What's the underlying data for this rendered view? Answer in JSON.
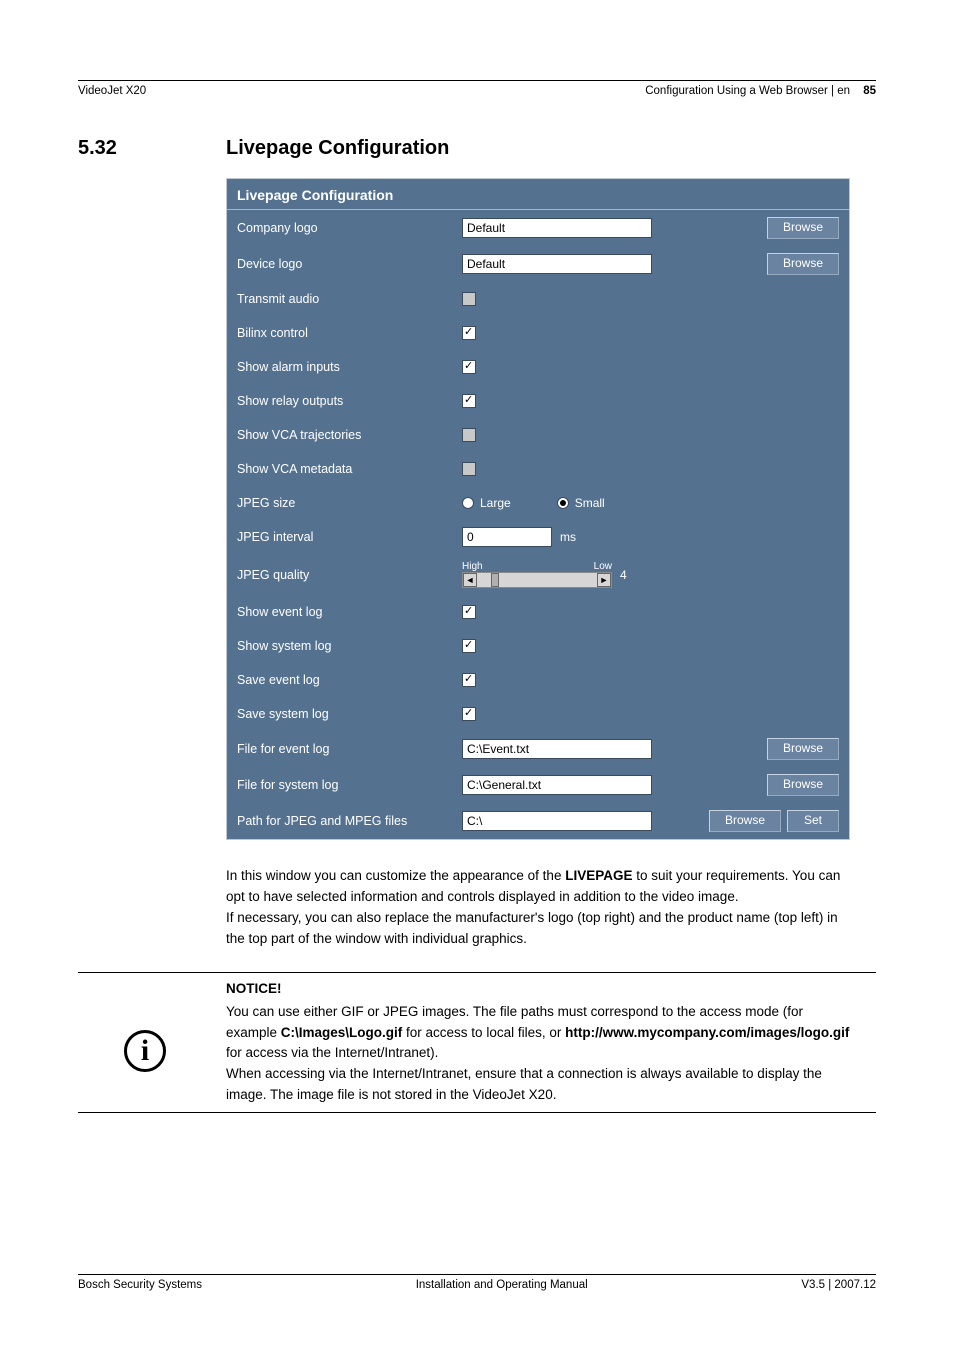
{
  "header": {
    "left": "VideoJet X20",
    "right": "Configuration Using a Web Browser | en",
    "page": "85"
  },
  "section": {
    "num": "5.32",
    "title": "Livepage Configuration"
  },
  "panel": {
    "title": "Livepage Configuration",
    "rows": {
      "company_logo": {
        "label": "Company logo",
        "value": "Default",
        "browse": "Browse"
      },
      "device_logo": {
        "label": "Device logo",
        "value": "Default",
        "browse": "Browse"
      },
      "transmit_audio": {
        "label": "Transmit audio"
      },
      "bilinx_control": {
        "label": "Bilinx control"
      },
      "show_alarm_inputs": {
        "label": "Show alarm inputs"
      },
      "show_relay_outputs": {
        "label": "Show relay outputs"
      },
      "show_vca_trajectories": {
        "label": "Show VCA trajectories"
      },
      "show_vca_metadata": {
        "label": "Show VCA metadata"
      },
      "jpeg_size": {
        "label": "JPEG size",
        "opt1": "Large",
        "opt2": "Small"
      },
      "jpeg_interval": {
        "label": "JPEG interval",
        "value": "0",
        "unit": "ms"
      },
      "jpeg_quality": {
        "label": "JPEG quality",
        "hi": "High",
        "lo": "Low",
        "value": "4"
      },
      "show_event_log": {
        "label": "Show event log"
      },
      "show_system_log": {
        "label": "Show system log"
      },
      "save_event_log": {
        "label": "Save event log"
      },
      "save_system_log": {
        "label": "Save system log"
      },
      "file_event_log": {
        "label": "File for event log",
        "value": "C:\\Event.txt",
        "browse": "Browse"
      },
      "file_system_log": {
        "label": "File for system log",
        "value": "C:\\General.txt",
        "browse": "Browse"
      },
      "path_files": {
        "label": "Path for JPEG and MPEG files",
        "value": "C:\\",
        "browse": "Browse",
        "set": "Set"
      }
    }
  },
  "body": {
    "p1a": "In this window you can customize the appearance of the ",
    "p1b": "LIVEPAGE",
    "p1c": " to suit your requirements. You can opt to have selected information and controls displayed in addition to the video image.",
    "p2": "If necessary, you can also replace the manufacturer's logo (top right) and the product name (top left) in the top part of the window with individual graphics."
  },
  "notice": {
    "title": "NOTICE!",
    "t1": "You can use either GIF or JPEG images. The file paths must correspond to the access mode (for example ",
    "b1": "C:\\Images\\Logo.gif",
    "t2": " for access to local files, or ",
    "b2": "http://www.mycompany.com/images/logo.gif",
    "t3": " for access via the Internet/Intranet).",
    "t4": "When accessing via the Internet/Intranet, ensure that a connection is always available to display the image. The image file is not stored in the VideoJet X20."
  },
  "footer": {
    "left": "Bosch Security Systems",
    "center": "Installation and Operating Manual",
    "right": "V3.5 | 2007.12"
  }
}
